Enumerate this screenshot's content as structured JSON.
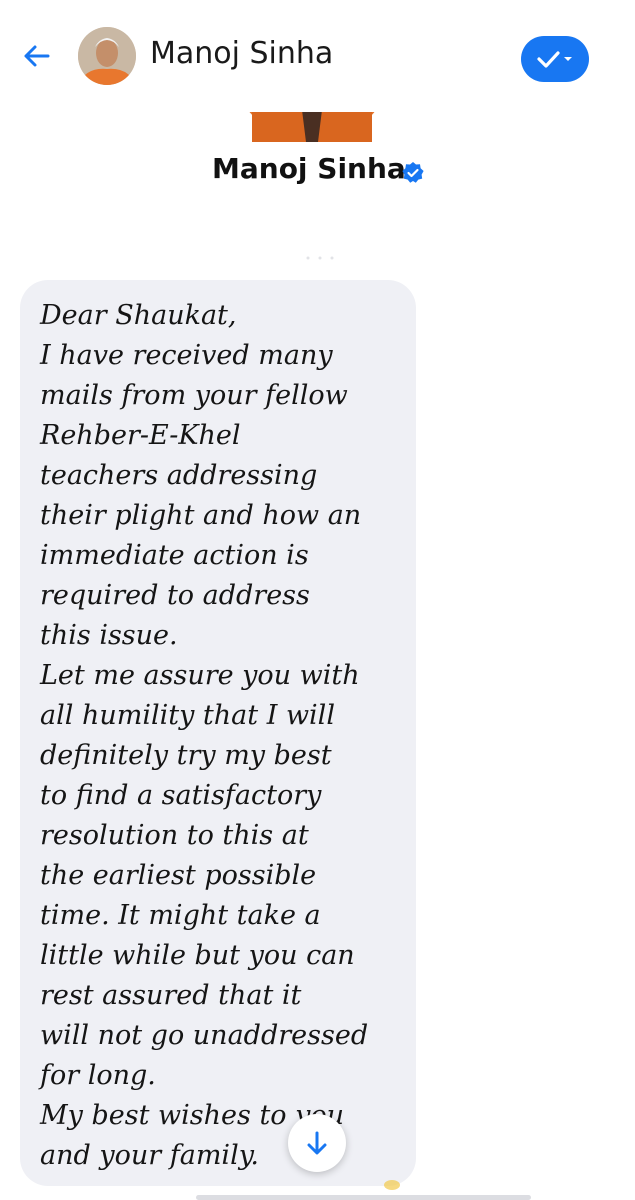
{
  "header": {
    "back_icon": "arrow-left-icon",
    "name": "Manoj Sinha",
    "action_icon": "check-chevron-icon",
    "accent": "#1877f2"
  },
  "profile": {
    "name": "Manoj Sinha",
    "verified_icon": "verified-badge-icon"
  },
  "message": {
    "lines": [
      "Dear Shaukat,",
      "I have received many",
      "mails from your fellow",
      "Rehber-E-Khel",
      "teachers addressing",
      "their plight and how an",
      "immediate action is",
      "required to address",
      "this issue.",
      "Let me assure you with",
      "all humility that I will",
      "definitely try my best",
      "to find a satisfactory",
      "resolution to this at",
      "the earliest possible",
      "time. It might take a",
      "little while but you can",
      "rest assured that it",
      "will not go unaddressed",
      "for long.",
      "My best wishes to you",
      "and your family."
    ],
    "bubble_color": "#eff0f5"
  },
  "scroll_button": {
    "icon": "arrow-down-icon"
  }
}
